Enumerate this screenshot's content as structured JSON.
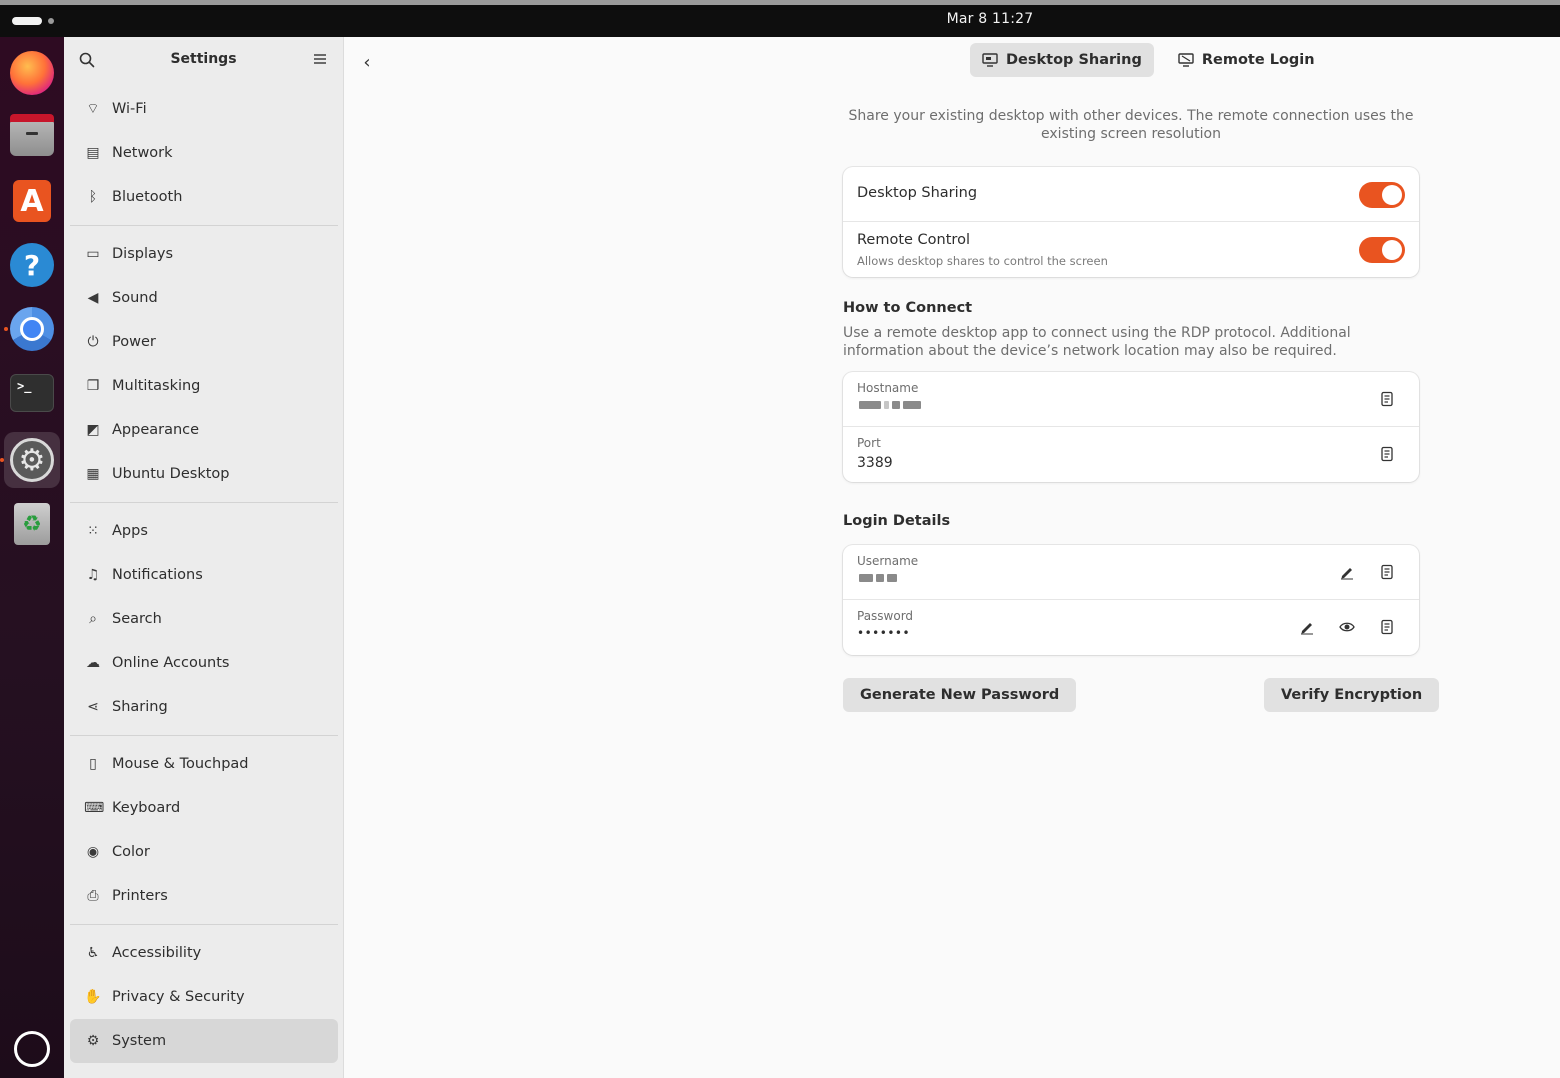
{
  "topbar": {
    "clock": "Mar 8  11:27"
  },
  "dock": {
    "apps": [
      {
        "name": "firefox"
      },
      {
        "name": "files"
      },
      {
        "name": "app-center"
      },
      {
        "name": "help"
      },
      {
        "name": "chromium"
      },
      {
        "name": "terminal"
      },
      {
        "name": "settings"
      },
      {
        "name": "trash"
      },
      {
        "name": "show-apps"
      }
    ]
  },
  "sidebar": {
    "title": "Settings",
    "groups": [
      [
        {
          "label": "Wi-Fi",
          "icon": "wifi-icon"
        },
        {
          "label": "Network",
          "icon": "network-icon"
        },
        {
          "label": "Bluetooth",
          "icon": "bluetooth-icon"
        }
      ],
      [
        {
          "label": "Displays",
          "icon": "display-icon"
        },
        {
          "label": "Sound",
          "icon": "speaker-icon"
        },
        {
          "label": "Power",
          "icon": "power-icon"
        },
        {
          "label": "Multitasking",
          "icon": "multitasking-icon"
        },
        {
          "label": "Appearance",
          "icon": "appearance-icon"
        },
        {
          "label": "Ubuntu Desktop",
          "icon": "ubuntu-desktop-icon"
        }
      ],
      [
        {
          "label": "Apps",
          "icon": "apps-grid-icon"
        },
        {
          "label": "Notifications",
          "icon": "bell-icon"
        },
        {
          "label": "Search",
          "icon": "search-icon"
        },
        {
          "label": "Online Accounts",
          "icon": "cloud-icon"
        },
        {
          "label": "Sharing",
          "icon": "share-icon"
        }
      ],
      [
        {
          "label": "Mouse & Touchpad",
          "icon": "mouse-icon"
        },
        {
          "label": "Keyboard",
          "icon": "keyboard-icon"
        },
        {
          "label": "Color",
          "icon": "color-icon"
        },
        {
          "label": "Printers",
          "icon": "printer-icon"
        }
      ],
      [
        {
          "label": "Accessibility",
          "icon": "accessibility-icon"
        },
        {
          "label": "Privacy & Security",
          "icon": "hand-icon"
        },
        {
          "label": "System",
          "icon": "gear-icon",
          "selected": true
        }
      ]
    ]
  },
  "tabs": [
    {
      "label": "Desktop Sharing",
      "active": true
    },
    {
      "label": "Remote Login",
      "active": false
    }
  ],
  "description": "Share your existing desktop with other devices. The remote connection uses the existing screen resolution",
  "sharing": {
    "desktop_sharing": {
      "title": "Desktop Sharing",
      "enabled": true
    },
    "remote_control": {
      "title": "Remote Control",
      "subtitle": "Allows desktop shares to control the screen",
      "enabled": true
    }
  },
  "how_to_connect": {
    "title": "How to Connect",
    "description": "Use a remote desktop app to connect using the RDP protocol. Additional information about the device’s network location may also be required.",
    "hostname_label": "Hostname",
    "port_label": "Port",
    "port_value": "3389"
  },
  "login_details": {
    "title": "Login Details",
    "username_label": "Username",
    "password_label": "Password",
    "password_value": "•••••••"
  },
  "buttons": {
    "generate": "Generate New Password",
    "verify": "Verify Encryption"
  },
  "colors": {
    "accent": "#e95420"
  }
}
